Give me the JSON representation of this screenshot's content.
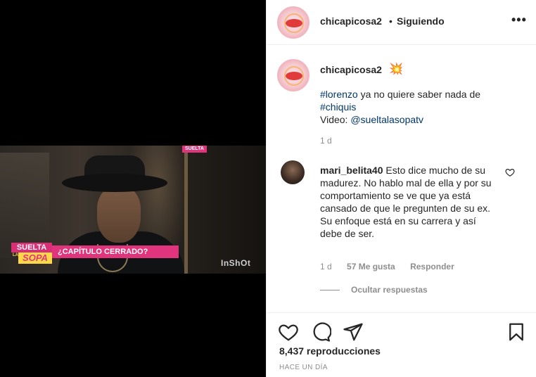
{
  "media": {
    "corner_tag": "SUELTA",
    "logo_top": "SUELTA",
    "logo_la": "LA",
    "logo_bottom": "SOPA",
    "headline": "¿CAPÍTULO CERRADO?",
    "watermark": "InShOt"
  },
  "header": {
    "username": "chicapicosa2",
    "separator": "•",
    "follow_status": "Siguiendo",
    "more": "•••"
  },
  "caption": {
    "username": "chicapicosa2",
    "emoji": "💥",
    "hashtag1": "#lorenzo",
    "line1_rest": " ya no quiere saber nada de",
    "hashtag2": "#chiquis",
    "video_label": "Video: ",
    "mention": "@sueltalasopatv",
    "time": "1 d"
  },
  "comment": {
    "username": "mari_belita40",
    "text": "Esto dice mucho de su madurez. No hablo mal de ella y por su comportamiento se ve que ya está cansado de que le pregunten de su ex. Su enfoque está en su carrera y así debe de ser.",
    "time": "1 d",
    "likes": "57 Me gusta",
    "reply": "Responder",
    "hide_replies": "Ocultar respuestas"
  },
  "actions": {
    "views": "8,437 reproducciones",
    "when": "HACE UN DÍA"
  },
  "colors": {
    "link": "#00376b",
    "muted": "#8e8e8e",
    "brand_pink": "#e0357c"
  },
  "icons": [
    "heart-icon",
    "comment-icon",
    "share-icon",
    "bookmark-icon",
    "more-icon"
  ]
}
